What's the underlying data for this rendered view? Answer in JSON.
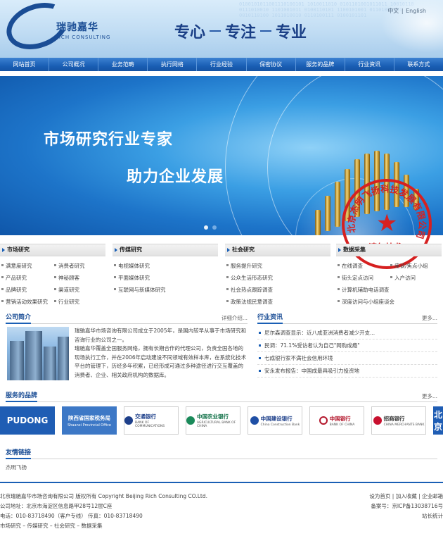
{
  "header": {
    "logo_cn": "瑞驰嘉华",
    "logo_en": "RICH CONSULTING",
    "slogan": [
      "专心",
      "专注",
      "专业"
    ],
    "lang_cn": "中文",
    "lang_sep": "|",
    "lang_en": "English"
  },
  "nav": [
    "网站首页",
    "公司概况",
    "业务范畴",
    "执行网络",
    "行业经验",
    "保密协议",
    "服务的品牌",
    "行业资讯",
    "联系方式"
  ],
  "banner": {
    "line1": "市场研究行业专家",
    "line2": "助力企业发展"
  },
  "stamp": {
    "ring": "北京杰明飞扬科技发展有限公司",
    "note": "请勿抄袭"
  },
  "categories": [
    {
      "title": "市场研究",
      "items": [
        "满意度研究",
        "消费者研究",
        "产品研究",
        "神秘顾客",
        "品牌研究",
        "渠道研究",
        "营销活动效果研究",
        "行业研究"
      ]
    },
    {
      "title": "传媒研究",
      "items": [
        "电视媒体研究",
        "平面媒体研究",
        "互联网与新媒体研究"
      ]
    },
    {
      "title": "社会研究",
      "items": [
        "服务提升研究",
        "公众生活形态研究",
        "社会热点跟踪调查",
        "政策法规民意调查"
      ]
    },
    {
      "title": "数据采集",
      "items": [
        "在线调查",
        "座谈/焦点小组",
        "街头定点访问",
        "入户访问",
        "计算机辅助电话调查",
        "深度访问与小组座谈会"
      ]
    }
  ],
  "intro": {
    "title": "公司简介",
    "more": "详细介绍...",
    "p1": "瑞驰嘉华市场咨询有限公司成立于2005年，是国内较早从事于市场研究和咨询行业的公司之一。",
    "p2": "瑞驰嘉华覆盖全国服务网络，拥有长期合作的代理公司，负责全国各地的现场执行工作，并在2006年启动建设不同领域有效样本库，在系统化技术平台的管理下，历经多年积累，已经形成可通过多种途径进行交互覆盖的消费者、企业、相关政府机构的数据库。"
  },
  "news": {
    "title": "行业资讯",
    "more": "更多...",
    "items": [
      "尼尔森调查显示：近八成亚洲消费者减少开支...",
      "民调：71.1%受访者认为自己\"网购成瘾\"",
      "七成银行家不满社会信用环境",
      "安永发布报告：中国成最具吸引力投资地"
    ]
  },
  "brands": {
    "title": "服务的品牌",
    "more": "更多...",
    "items": [
      {
        "name": "PUDONG",
        "sub": ""
      },
      {
        "name": "陕西省国家税务局",
        "sub": "Shaanxi Provincial Office"
      },
      {
        "name": "交通银行",
        "sub": "BANK OF COMMUNICATIONS"
      },
      {
        "name": "中国农业银行",
        "sub": "AGRICULTURAL BANK OF CHINA"
      },
      {
        "name": "中国建设银行",
        "sub": "China Construction Bank"
      },
      {
        "name": "中国银行",
        "sub": "BANK OF CHINA"
      },
      {
        "name": "招商银行",
        "sub": "CHINA MERCHANTS BANK"
      },
      {
        "name": "北京",
        "sub": ""
      }
    ]
  },
  "links": {
    "title": "友情链接",
    "item": "杰明飞扬"
  },
  "footer": {
    "line1": "北京瑞驰嘉华市场咨询有限公司 版权所有 Copyright Beijing Rich Consulting CO.Ltd.",
    "line2": "公司地址：北京市海淀区信息路甲28号12层C座",
    "line3": "电话：010-83718490（客户专线）      传真：010-83718490",
    "line4": "市场研究 – 传媒研究 – 社会研究 – 数据采集",
    "r1": "设为首页 | 加入收藏 | 企业邮箱",
    "r2": "备案号：京ICP备13038716号",
    "r3": "站长统计"
  }
}
